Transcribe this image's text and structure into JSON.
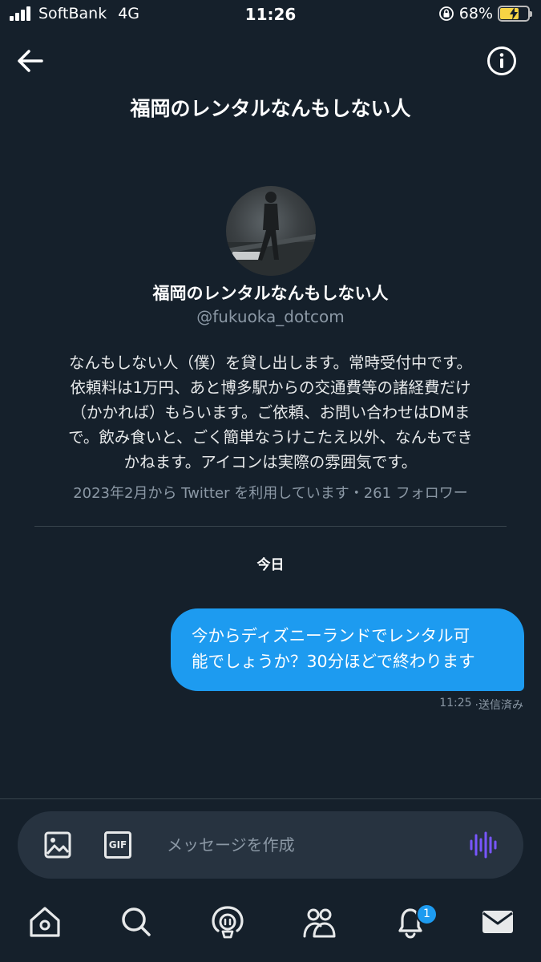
{
  "status_bar": {
    "carrier": "SoftBank",
    "network": "4G",
    "time": "11:26",
    "battery_percent": "68%",
    "battery_level": 0.68,
    "battery_color": "#f6d444"
  },
  "header": {
    "title": "福岡のレンタルなんもしない人",
    "back_icon": "arrow-left-icon",
    "info_icon": "info-icon"
  },
  "profile": {
    "name": "福岡のレンタルなんもしない人",
    "handle": "@fukuoka_dotcom",
    "bio_lines": [
      "なんもしない人（僕）を貸し出します。常時受付中です。",
      "依頼料は1万円、あと博多駅からの交通費等の諸経費だけ",
      "（かかれば）もらいます。ご依頼、お問い合わせはDMま",
      "で。飲み食いと、ごく簡単なうけこたえ以外、なんもでき",
      "かねます。アイコンは実際の雰囲気です。"
    ],
    "meta": "2023年2月から Twitter を利用しています・261 フォロワー"
  },
  "conversation": {
    "day_label": "今日",
    "messages": [
      {
        "lines": [
          "今からディズニーランドでレンタル可",
          "能でしょうか？30分ほどで終わります"
        ],
        "time": "11:25",
        "status": "·送信済み"
      }
    ]
  },
  "composer": {
    "placeholder": "メッセージを作成",
    "gif_label": "GIF",
    "image_icon": "image-icon",
    "voice_icon": "voice-wave-icon",
    "voice_color": "#7856ff"
  },
  "tabbar": {
    "notification_count": "1",
    "tabs": [
      "home-icon",
      "search-icon",
      "spaces-icon",
      "communities-icon",
      "notifications-icon",
      "messages-icon"
    ]
  },
  "colors": {
    "background": "#15202b",
    "accent": "#1d9bf0",
    "muted": "#8b98a5"
  }
}
